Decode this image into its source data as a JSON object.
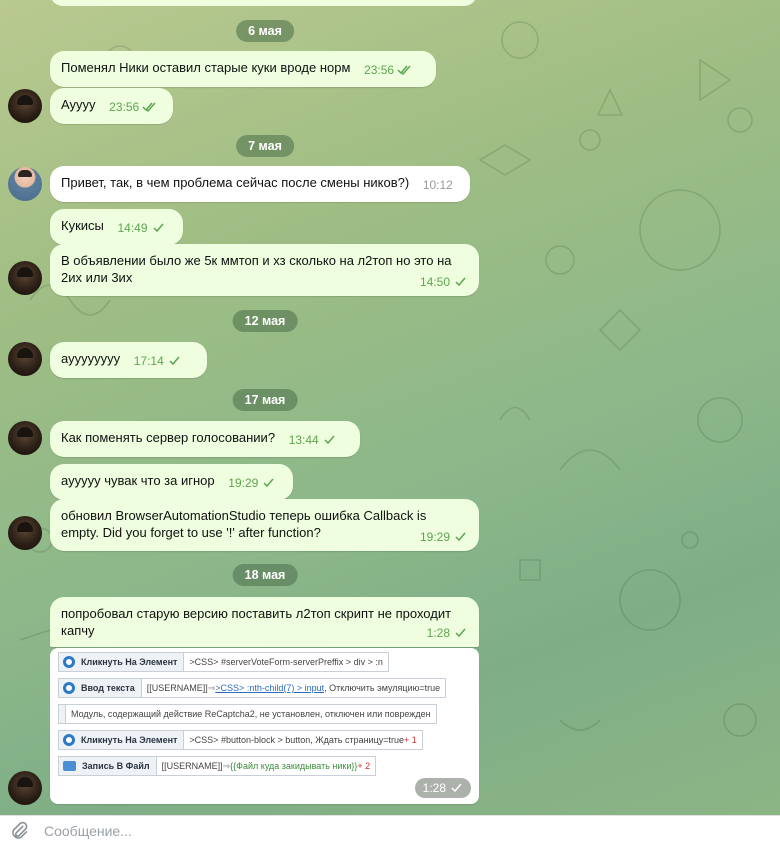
{
  "dates": [
    "6 мая",
    "7 мая",
    "12 мая",
    "17 мая",
    "18 мая"
  ],
  "messages": [
    {
      "text": "Поменял Ники оставил старые куки вроде норм",
      "time": "23:56"
    },
    {
      "text": "Ауууу",
      "time": "23:56"
    },
    {
      "text": "Привет, так, в чем проблема сейчас после смены ников?)",
      "time": "10:12"
    },
    {
      "text": "Кукисы",
      "time": "14:49"
    },
    {
      "text": "В объявлении было же 5к ммтоп и хз сколько на л2топ но это на 2их или 3их",
      "time": "14:50"
    },
    {
      "text": "ауууууууу",
      "time": "17:14"
    },
    {
      "text": "Как поменять сервер голосовании?",
      "time": "13:44"
    },
    {
      "text": "аууууу чувак что за игнор",
      "time": "19:29"
    },
    {
      "text": "обновил BrowserAutomationStudio  теперь ошибка Callback is empty. Did you forget to use '!' after function?",
      "time": "19:29"
    },
    {
      "text": "попробовал старую версию поставить л2топ скрипт не проходит капчу",
      "time": "1:28"
    }
  ],
  "screenshot": {
    "time": "1:28",
    "rows": [
      {
        "action": "Кликнуть На Элемент",
        "parts": [
          {
            "t": ">CSS> #serverVoteForm-serverPreffix > div > :n",
            "c": ""
          }
        ]
      },
      {
        "action": "Ввод текста",
        "parts": [
          {
            "t": "[[USERNAME]] ",
            "c": ""
          },
          {
            "t": "⇒ ",
            "c": "grey"
          },
          {
            "t": ">CSS> :nth-child(7) > input",
            "c": "blue"
          },
          {
            "t": ", Отключить эмуляцию=",
            "c": ""
          },
          {
            "t": "true",
            "c": "grey"
          }
        ]
      },
      {
        "action": "",
        "parts": [
          {
            "t": "Модуль, содержащий действие ReCaptcha2, не установлен, отключен или поврежден",
            "c": ""
          }
        ]
      },
      {
        "action": "Кликнуть На Элемент",
        "parts": [
          {
            "t": ">CSS> #button-block > button",
            "c": ""
          },
          {
            "t": ", Ждать страницу=",
            "c": ""
          },
          {
            "t": "true",
            "c": ""
          },
          {
            "t": " + 1",
            "c": "red"
          }
        ]
      },
      {
        "action": "Запись В Файл",
        "parts": [
          {
            "t": "[[USERNAME]] ",
            "c": ""
          },
          {
            "t": "⇒ ",
            "c": "grey"
          },
          {
            "t": "{{Файл куда закидывать ники}}",
            "c": "green"
          },
          {
            "t": " + 2",
            "c": "red"
          }
        ]
      }
    ]
  },
  "composer": {
    "placeholder": "Сообщение..."
  },
  "colors": {
    "bubble_out": "#eefedf",
    "bubble_in": "#ffffff",
    "check_green": "#5fa44f",
    "date_pill": "#4a6e48"
  }
}
